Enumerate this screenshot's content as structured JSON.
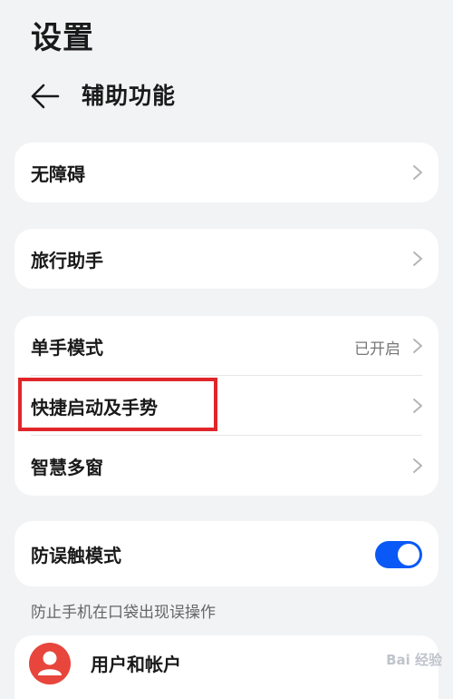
{
  "app": {
    "title": "设置"
  },
  "header": {
    "title": "辅助功能",
    "back_icon": "arrow-left-icon"
  },
  "groups": [
    {
      "items": [
        {
          "label": "无障碍"
        }
      ]
    },
    {
      "items": [
        {
          "label": "旅行助手"
        }
      ]
    },
    {
      "items": [
        {
          "label": "单手模式",
          "status": "已开启"
        },
        {
          "label": "快捷启动及手势"
        },
        {
          "label": "智慧多窗"
        }
      ]
    },
    {
      "items": [
        {
          "label": "防误触模式",
          "toggle_on": true
        }
      ]
    }
  ],
  "hint": "防止手机在口袋出现误操作",
  "account": {
    "label": "用户和帐户"
  },
  "watermark": "Bai 经验",
  "colors": {
    "accent": "#0a59f7",
    "highlight": "#e0262a",
    "avatar": "#e8453c"
  }
}
